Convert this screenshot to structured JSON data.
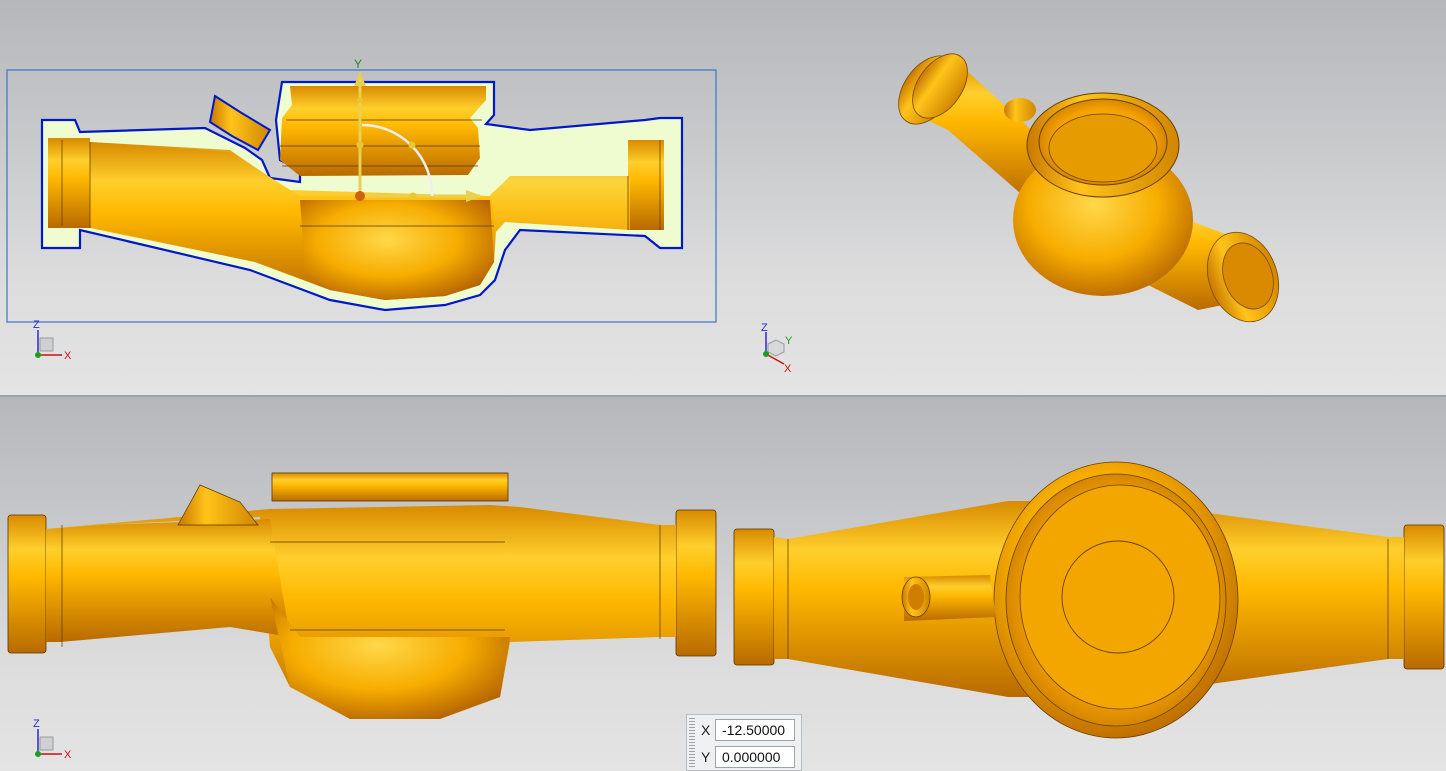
{
  "triads": {
    "top_left": {
      "z": "Z",
      "x": "X"
    },
    "top_right": {
      "z": "Z",
      "y": "Y",
      "x": "X"
    },
    "bottom_left": {
      "z": "Z",
      "x": "X"
    }
  },
  "wcs_handle": {
    "y_label": "Y"
  },
  "coordinate_panel": {
    "x_label": "X",
    "x_value": "-12.50000",
    "y_label": "Y",
    "y_value": "0.000000"
  },
  "colors": {
    "part_gold": "#f2a800",
    "section_fill": "#eefcd0",
    "section_outline": "#0018c8",
    "selection_box": "#3c74c6",
    "viewport_bg_top": "#b5b7ba",
    "viewport_bg_bottom": "#e4e4e4"
  },
  "icons": [
    "triad-icon",
    "move-handle-icon",
    "grip-icon"
  ]
}
